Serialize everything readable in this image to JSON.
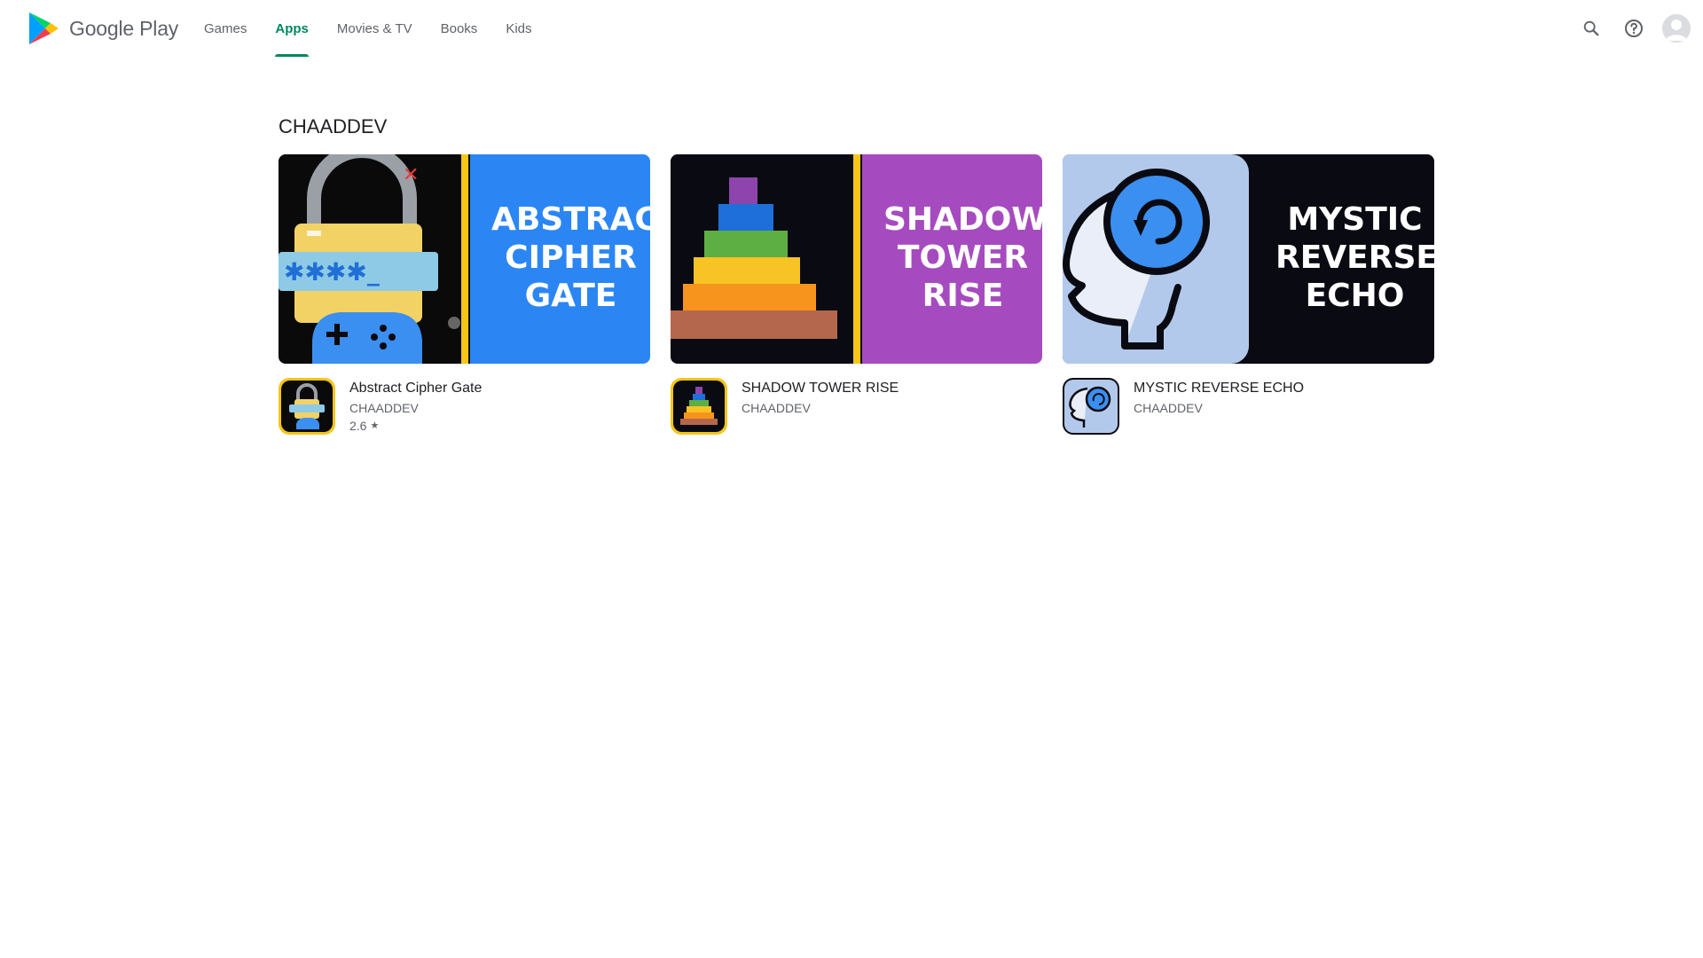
{
  "header": {
    "brand": "Google Play",
    "nav": [
      {
        "label": "Games",
        "active": false
      },
      {
        "label": "Apps",
        "active": true
      },
      {
        "label": "Movies & TV",
        "active": false
      },
      {
        "label": "Books",
        "active": false
      },
      {
        "label": "Kids",
        "active": false
      }
    ],
    "actions": [
      "search-icon",
      "help-icon",
      "account-avatar"
    ]
  },
  "section": {
    "title": "CHAADDEV"
  },
  "apps": [
    {
      "name": "Abstract Cipher Gate",
      "developer": "CHAADDEV",
      "rating": "2.6",
      "banner_lines": [
        "ABSTRACT",
        "CIPHER",
        "GATE"
      ],
      "banner_color": "#2b86f3"
    },
    {
      "name": "SHADOW TOWER RISE",
      "developer": "CHAADDEV",
      "rating": null,
      "banner_lines": [
        "SHADOW",
        "TOWER",
        "RISE"
      ],
      "banner_color": "#a64bbf"
    },
    {
      "name": "MYSTIC REVERSE ECHO",
      "developer": "CHAADDEV",
      "rating": null,
      "banner_lines": [
        "MYSTIC",
        "REVERSE",
        "ECHO"
      ],
      "banner_color": "#0a0a12"
    }
  ],
  "colors": {
    "accent": "#01875f",
    "text_primary": "#202124",
    "text_secondary": "#5f6368"
  }
}
